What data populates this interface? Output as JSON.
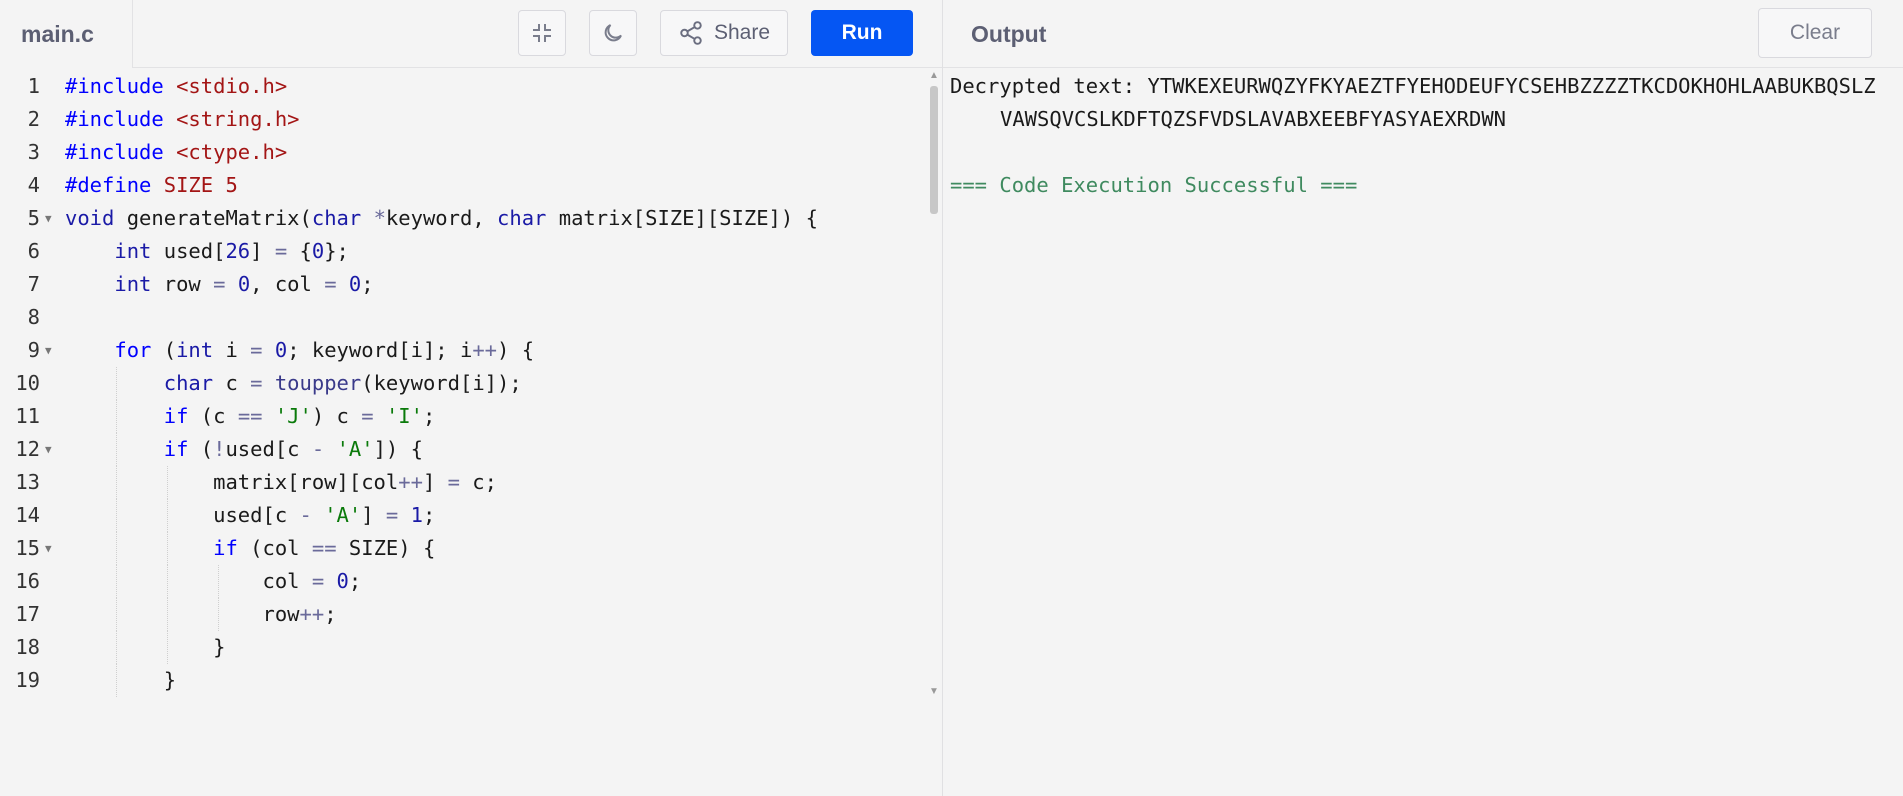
{
  "editor": {
    "filename": "main.c",
    "share_label": "Share",
    "run_label": "Run",
    "lines": [
      {
        "n": "1",
        "html": "<span class=\"kw\">#include</span> <span class=\"str\">&lt;stdio.h&gt;</span>"
      },
      {
        "n": "2",
        "html": "<span class=\"kw\">#include</span> <span class=\"str\">&lt;string.h&gt;</span>"
      },
      {
        "n": "3",
        "html": "<span class=\"kw\">#include</span> <span class=\"str\">&lt;ctype.h&gt;</span>"
      },
      {
        "n": "4",
        "html": "<span class=\"kw\">#define</span> <span class=\"str\">SIZE 5</span>"
      },
      {
        "n": "5",
        "fold": true,
        "html": "<span class=\"kw2\">void</span> generateMatrix(<span class=\"kw2\">char</span> <span class=\"op\">*</span>keyword, <span class=\"kw2\">char</span> matrix[SIZE][SIZE]) {"
      },
      {
        "n": "6",
        "html": "    <span class=\"kw2\">int</span> used[<span class=\"num\">26</span>] <span class=\"op\">=</span> {<span class=\"num\">0</span>};"
      },
      {
        "n": "7",
        "html": "    <span class=\"kw2\">int</span> row <span class=\"op\">=</span> <span class=\"num\">0</span>, col <span class=\"op\">=</span> <span class=\"num\">0</span>;"
      },
      {
        "n": "8",
        "html": ""
      },
      {
        "n": "9",
        "fold": true,
        "html": "    <span class=\"kw\">for</span> (<span class=\"kw2\">int</span> i <span class=\"op\">=</span> <span class=\"num\">0</span>; keyword[i]; i<span class=\"op\">++</span>) {"
      },
      {
        "n": "10",
        "html": "        <span class=\"kw2\">char</span> c <span class=\"op\">=</span> <span class=\"fn\">toupper</span>(keyword[i]);",
        "guides": [
          1
        ]
      },
      {
        "n": "11",
        "html": "        <span class=\"kw\">if</span> (c <span class=\"op\">==</span> <span class=\"chr\">'J'</span>) c <span class=\"op\">=</span> <span class=\"chr\">'I'</span>;",
        "guides": [
          1
        ]
      },
      {
        "n": "12",
        "fold": true,
        "html": "        <span class=\"kw\">if</span> (<span class=\"op\">!</span>used[c <span class=\"op\">-</span> <span class=\"chr\">'A'</span>]) {",
        "guides": [
          1
        ]
      },
      {
        "n": "13",
        "html": "            matrix[row][col<span class=\"op\">++</span>] <span class=\"op\">=</span> c;",
        "guides": [
          1,
          2
        ]
      },
      {
        "n": "14",
        "html": "            used[c <span class=\"op\">-</span> <span class=\"chr\">'A'</span>] <span class=\"op\">=</span> <span class=\"num\">1</span>;",
        "guides": [
          1,
          2
        ]
      },
      {
        "n": "15",
        "fold": true,
        "html": "            <span class=\"kw\">if</span> (col <span class=\"op\">==</span> SIZE) {",
        "guides": [
          1,
          2
        ]
      },
      {
        "n": "16",
        "html": "                col <span class=\"op\">=</span> <span class=\"num\">0</span>;",
        "guides": [
          1,
          2,
          3
        ]
      },
      {
        "n": "17",
        "html": "                row<span class=\"op\">++</span>;",
        "guides": [
          1,
          2,
          3
        ]
      },
      {
        "n": "18",
        "html": "            }",
        "guides": [
          1,
          2
        ]
      },
      {
        "n": "19",
        "html": "        }",
        "guides": [
          1
        ]
      }
    ]
  },
  "output": {
    "title": "Output",
    "clear_label": "Clear",
    "line1": "Decrypted text: YTWKEXEURWQZYFKYAEZTFYEHODEUFYCSEHBZZZZTKCDOKHOHLAABUKBQSLZ",
    "line2": "VAWSQVCSLKDFTQZSFVDSLAVABXEEBFYASYAEXRDWN",
    "status": "=== Code Execution Successful ==="
  }
}
